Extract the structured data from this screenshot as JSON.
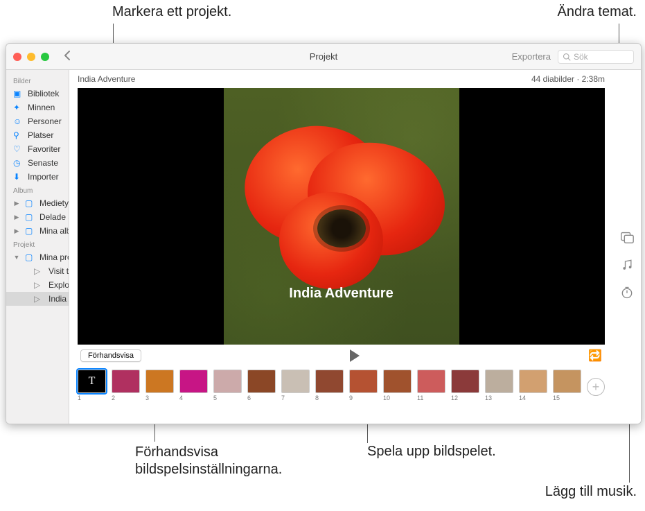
{
  "callouts": {
    "select_project": "Markera ett projekt.",
    "change_theme": "Ändra temat.",
    "preview_settings": "Förhandsvisa bildspelsinställningarna.",
    "play_slideshow": "Spela upp bildspelet.",
    "add_music": "Lägg till musik."
  },
  "window": {
    "title": "Projekt",
    "export": "Exportera",
    "search_placeholder": "Sök"
  },
  "sidebar": {
    "section_images": "Bilder",
    "items_images": [
      {
        "label": "Bibliotek"
      },
      {
        "label": "Minnen"
      },
      {
        "label": "Personer"
      },
      {
        "label": "Platser"
      },
      {
        "label": "Favoriter"
      },
      {
        "label": "Senaste"
      },
      {
        "label": "Importer"
      }
    ],
    "section_album": "Album",
    "items_album": [
      {
        "label": "Medietyper"
      },
      {
        "label": "Delade album"
      },
      {
        "label": "Mina album"
      }
    ],
    "section_project": "Projekt",
    "my_projects": "Mina projekt",
    "projects": [
      {
        "label": "Visit to Lisbon"
      },
      {
        "label": "Exploring Mor…"
      },
      {
        "label": "India Adventure"
      }
    ]
  },
  "main": {
    "project_title": "India Adventure",
    "meta": "44 diabilder · 2:38m",
    "slide_title_overlay": "India Adventure",
    "preview_button": "Förhandsvisa",
    "thumb_title_glyph": "T",
    "thumb_count": 15
  }
}
